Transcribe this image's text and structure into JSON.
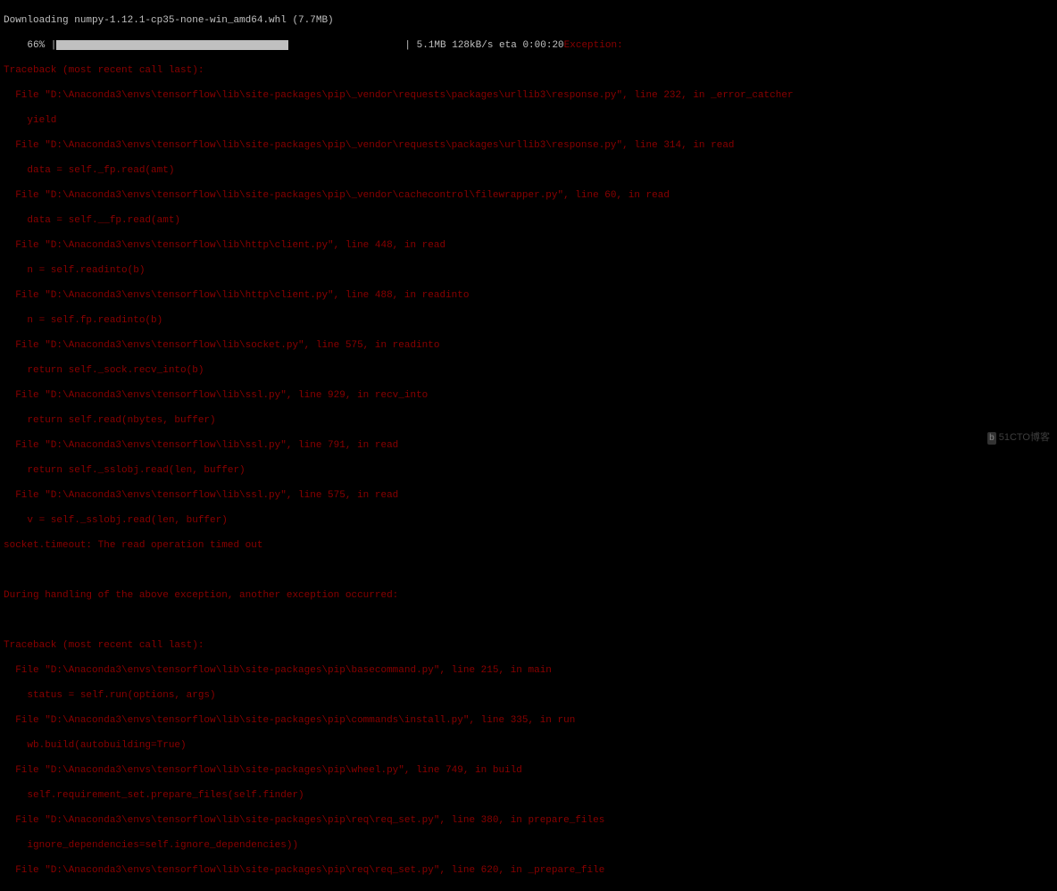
{
  "download": {
    "header": "Downloading numpy-1.12.1-cp35-none-win_amd64.whl (7.7MB)",
    "percent": "    66% |",
    "stats": "| 5.1MB 128kB/s eta 0:00:20"
  },
  "exception_label": "Exception:",
  "tb1": {
    "header": "Traceback (most recent call last):",
    "f1": "  File \"D:\\Anaconda3\\envs\\tensorflow\\lib\\site-packages\\pip\\_vendor\\requests\\packages\\urllib3\\response.py\", line 232, in _error_catcher",
    "l1": "    yield",
    "f2": "  File \"D:\\Anaconda3\\envs\\tensorflow\\lib\\site-packages\\pip\\_vendor\\requests\\packages\\urllib3\\response.py\", line 314, in read",
    "l2": "    data = self._fp.read(amt)",
    "f3": "  File \"D:\\Anaconda3\\envs\\tensorflow\\lib\\site-packages\\pip\\_vendor\\cachecontrol\\filewrapper.py\", line 60, in read",
    "l3": "    data = self.__fp.read(amt)",
    "f4": "  File \"D:\\Anaconda3\\envs\\tensorflow\\lib\\http\\client.py\", line 448, in read",
    "l4": "    n = self.readinto(b)",
    "f5": "  File \"D:\\Anaconda3\\envs\\tensorflow\\lib\\http\\client.py\", line 488, in readinto",
    "l5": "    n = self.fp.readinto(b)",
    "f6": "  File \"D:\\Anaconda3\\envs\\tensorflow\\lib\\socket.py\", line 575, in readinto",
    "l6": "    return self._sock.recv_into(b)",
    "f7": "  File \"D:\\Anaconda3\\envs\\tensorflow\\lib\\ssl.py\", line 929, in recv_into",
    "l7": "    return self.read(nbytes, buffer)",
    "f8": "  File \"D:\\Anaconda3\\envs\\tensorflow\\lib\\ssl.py\", line 791, in read",
    "l8": "    return self._sslobj.read(len, buffer)",
    "f9": "  File \"D:\\Anaconda3\\envs\\tensorflow\\lib\\ssl.py\", line 575, in read",
    "l9": "    v = self._sslobj.read(len, buffer)",
    "err": "socket.timeout: The read operation timed out"
  },
  "during": "During handling of the above exception, another exception occurred:",
  "tb2": {
    "header": "Traceback (most recent call last):",
    "f1": "  File \"D:\\Anaconda3\\envs\\tensorflow\\lib\\site-packages\\pip\\basecommand.py\", line 215, in main",
    "l1": "    status = self.run(options, args)",
    "f2": "  File \"D:\\Anaconda3\\envs\\tensorflow\\lib\\site-packages\\pip\\commands\\install.py\", line 335, in run",
    "l2": "    wb.build(autobuilding=True)",
    "f3": "  File \"D:\\Anaconda3\\envs\\tensorflow\\lib\\site-packages\\pip\\wheel.py\", line 749, in build",
    "l3": "    self.requirement_set.prepare_files(self.finder)",
    "f4": "  File \"D:\\Anaconda3\\envs\\tensorflow\\lib\\site-packages\\pip\\req\\req_set.py\", line 380, in prepare_files",
    "l4": "    ignore_dependencies=self.ignore_dependencies))",
    "f5": "  File \"D:\\Anaconda3\\envs\\tensorflow\\lib\\site-packages\\pip\\req\\req_set.py\", line 620, in _prepare_file"
  },
  "watermark": "51CTO博客"
}
